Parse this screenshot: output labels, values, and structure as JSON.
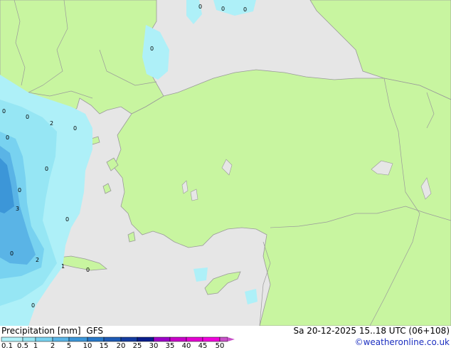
{
  "title": "Precipitation [mm]",
  "model": "GFS",
  "valid_time": "Sa 20-12-2025 15..18 UTC (06+108)",
  "credit": "©weatheronline.co.uk",
  "legend": {
    "ticks": [
      "0.1",
      "0.5",
      "1",
      "2",
      "5",
      "10",
      "15",
      "20",
      "25",
      "30",
      "35",
      "40",
      "45",
      "50"
    ],
    "colors": [
      "#aef0f8",
      "#96e6f4",
      "#78d2f0",
      "#5ab4e6",
      "#3c96d8",
      "#2878c8",
      "#1e5ab4",
      "#143ca0",
      "#0a1e8c",
      "#9c00c8",
      "#c800c8",
      "#e400d2",
      "#f000dc",
      "#c850c8"
    ]
  },
  "map_colors": {
    "sea": "#e6e6e6",
    "land": "#c8f5a0",
    "border": "#9a9a9a"
  },
  "point_values": [
    "2",
    "0",
    "3",
    "0",
    "2",
    "1",
    "0",
    "0",
    "0",
    "0",
    "0",
    "0",
    "0",
    "0",
    "0",
    "0",
    "0",
    "0"
  ]
}
